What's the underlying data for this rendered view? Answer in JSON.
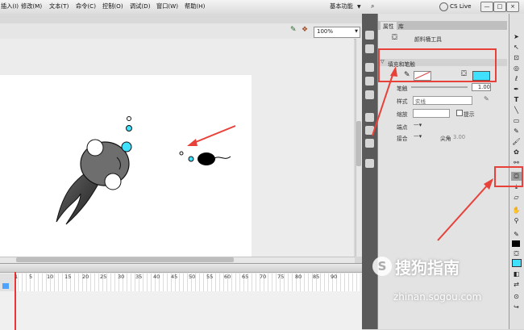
{
  "menu": {
    "items": [
      "插入(I)",
      "修改(M)",
      "文本(T)",
      "命令(C)",
      "控制(O)",
      "调试(D)",
      "窗口(W)",
      "帮助(H)"
    ],
    "workspace": "基本功能",
    "cs_live": "CS Live",
    "minimize": "—",
    "maximize": "□",
    "close": "×"
  },
  "toolbar": {
    "zoom": "100%"
  },
  "timeline": {
    "frames": [
      "1",
      "5",
      "10",
      "15",
      "20",
      "25",
      "30",
      "35",
      "40",
      "45",
      "50",
      "55",
      "60",
      "65",
      "70",
      "75",
      "80",
      "85",
      "90"
    ]
  },
  "properties": {
    "tab_properties": "属性",
    "tab_library": "库",
    "tool_name": "颜料桶工具",
    "section": "填充和笔触",
    "stroke_label": "笔触",
    "stroke_value": "1.00",
    "style_label": "样式",
    "style_value": "实线",
    "scale_label": "缩放",
    "hint_label": "提示",
    "cap_label": "端点",
    "join_label": "接合",
    "miter_label": "尖角",
    "miter_value": "3.00",
    "fill_color": "#40e0ff"
  },
  "watermark": {
    "text": "搜狗指南",
    "url": "zhinan.sogou.com"
  }
}
